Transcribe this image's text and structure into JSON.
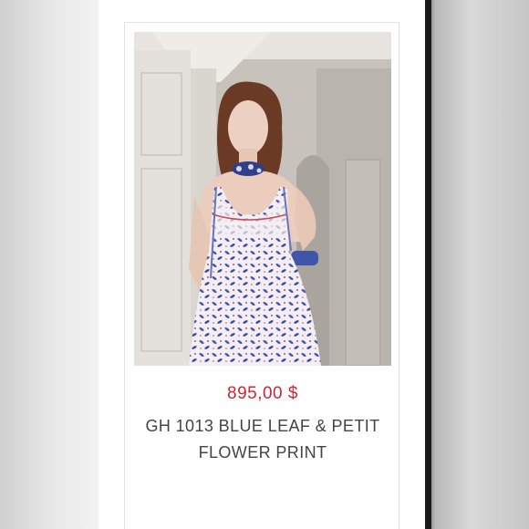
{
  "product": {
    "price": "895,00 $",
    "title_line1": "GH 1013 BLUE LEAF & PETIT",
    "title_line2": "FLOWER PRINT"
  },
  "colors": {
    "price": "#c8283a",
    "title": "#444444"
  }
}
